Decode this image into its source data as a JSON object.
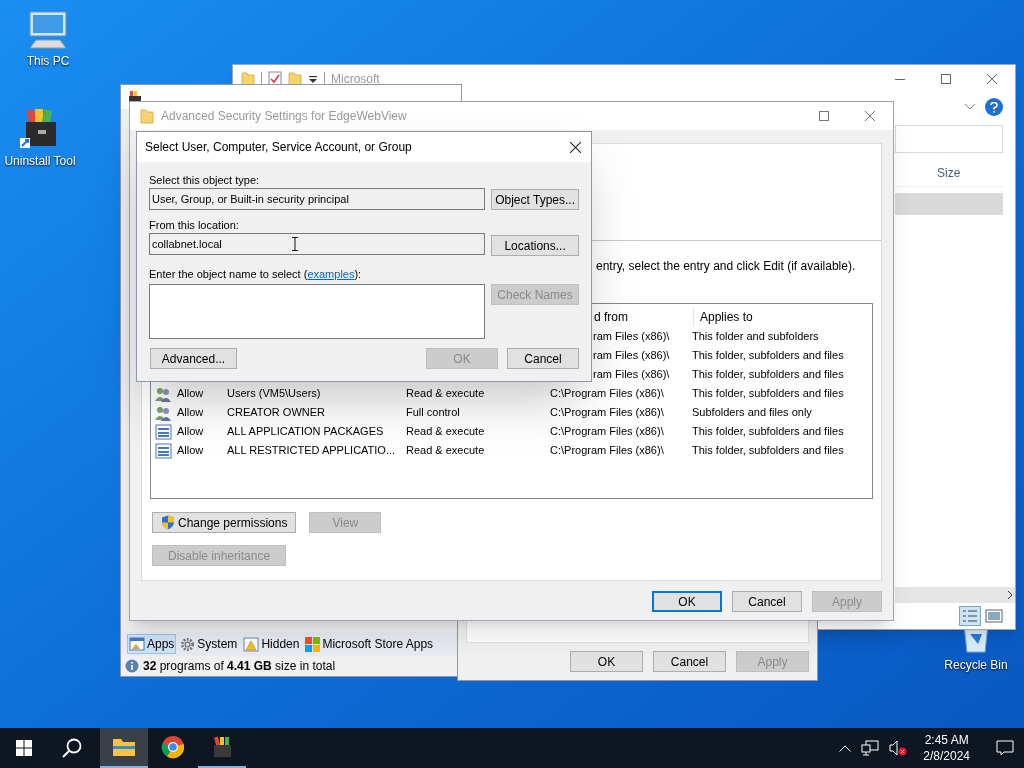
{
  "desktop_icons": [
    {
      "label": "This PC",
      "kind": "computer"
    },
    {
      "label": "Uninstall Tool",
      "kind": "toolbox"
    },
    {
      "label": "Recycle Bin",
      "kind": "bin"
    }
  ],
  "explorer": {
    "title": "Microsoft",
    "column": "Size"
  },
  "uninstall_tool": {
    "tabs": [
      {
        "label": "Apps",
        "selected": true,
        "kind": "apps"
      },
      {
        "label": "System",
        "selected": false,
        "kind": "gear"
      },
      {
        "label": "Hidden",
        "selected": false,
        "kind": "warning"
      },
      {
        "label": "Microsoft Store Apps",
        "selected": false,
        "kind": "store"
      }
    ],
    "status": "**32** programs of **4.41 GB** size in total"
  },
  "properties": {
    "buttons": [
      {
        "label": "OK",
        "disabled": false
      },
      {
        "label": "Cancel",
        "disabled": false
      },
      {
        "label": "Apply",
        "disabled": true
      }
    ]
  },
  "advanced_security": {
    "title": "Advanced Security Settings for EdgeWebView",
    "instruction": "entry, select the entry and click Edit (if available).",
    "table": {
      "columns": [
        "d from",
        "Applies to"
      ],
      "rows": [
        {
          "inherited_from": "ram Files (x86)\\",
          "applies_to": "This folder and subfolders"
        },
        {
          "inherited_from": "ram Files (x86)\\",
          "applies_to": "This folder, subfolders and files"
        },
        {
          "inherited_from": "ram Files (x86)\\",
          "applies_to": "This folder, subfolders and files"
        },
        {
          "kind": "group",
          "type": "Allow",
          "principal": "Users (VM5\\Users)",
          "access": "Read & execute",
          "inherited_from": "C:\\Program Files (x86)\\",
          "applies_to": "This folder, subfolders and files"
        },
        {
          "kind": "group",
          "type": "Allow",
          "principal": "CREATOR OWNER",
          "access": "Full control",
          "inherited_from": "C:\\Program Files (x86)\\",
          "applies_to": "Subfolders and files only"
        },
        {
          "kind": "package",
          "type": "Allow",
          "principal": "ALL APPLICATION PACKAGES",
          "access": "Read & execute",
          "inherited_from": "C:\\Program Files (x86)\\",
          "applies_to": "This folder, subfolders and files"
        },
        {
          "kind": "package",
          "type": "Allow",
          "principal": "ALL RESTRICTED APPLICATIO...",
          "access": "Read & execute",
          "inherited_from": "C:\\Program Files (x86)\\",
          "applies_to": "This folder, subfolders and files"
        }
      ]
    },
    "buttons": [
      {
        "label": "Change permissions",
        "disabled": false,
        "kind": "shield"
      },
      {
        "label": "View",
        "disabled": true
      },
      {
        "label": "Disable inheritance",
        "disabled": true
      }
    ],
    "footer_buttons": [
      {
        "label": "OK",
        "disabled": false,
        "default": true
      },
      {
        "label": "Cancel",
        "disabled": false,
        "default": false
      },
      {
        "label": "Apply",
        "disabled": true,
        "default": false
      }
    ]
  },
  "select_dialog": {
    "title": "Select User, Computer, Service Account, or Group",
    "object_type_label": "Select this object type:",
    "object_type": "User, Group, or Built-in security principal",
    "object_types_button": "Object Types...",
    "location_label": "From this location:",
    "location": "collabnet.local",
    "locations_button": "Locations...",
    "name_label_before": "Enter the object name to select (",
    "name_label_link": "examples",
    "name_label_after": "):",
    "check_names": {
      "label": "Check Names",
      "disabled": true
    },
    "advanced_button": "Advanced...",
    "ok": {
      "label": "OK",
      "disabled": true
    },
    "cancel": {
      "label": "Cancel",
      "disabled": false
    }
  },
  "taskbar": {
    "apps": [
      {
        "kind": "explorer",
        "active": true,
        "running": true
      },
      {
        "kind": "chrome",
        "active": false,
        "running": false
      },
      {
        "kind": "toolbox",
        "active": false,
        "running": true
      }
    ],
    "time": "2:45 AM",
    "date": "2/8/2024"
  }
}
